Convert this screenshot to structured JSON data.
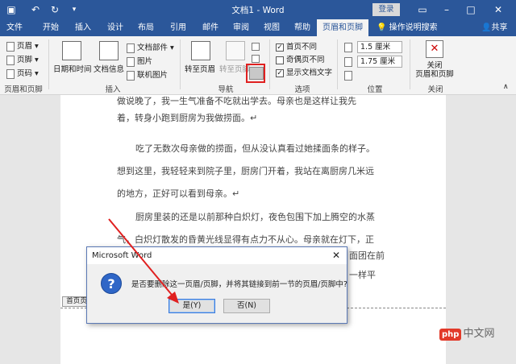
{
  "titlebar": {
    "title": "文档1 - Word",
    "signin": "登录",
    "save_icon": "save-icon",
    "undo_icon": "undo-icon",
    "redo_icon": "redo-icon"
  },
  "tabs": [
    "文件",
    "开始",
    "插入",
    "设计",
    "布局",
    "引用",
    "邮件",
    "审阅",
    "视图",
    "帮助",
    "页眉和页脚"
  ],
  "tell_me": "操作说明搜索",
  "share": "共享",
  "ribbon": {
    "group1": {
      "items": [
        "页眉",
        "页脚",
        "页码"
      ],
      "label": "页眉和页脚"
    },
    "group2": {
      "items": [
        "日期和时间",
        "文档信息",
        "文档部件",
        "图片",
        "联机图片"
      ],
      "label": "插入"
    },
    "group3": {
      "items": [
        "转至页眉",
        "转至页脚"
      ],
      "label": "导航"
    },
    "group4": {
      "items": [
        "首页不同",
        "奇偶页不同",
        "显示文档文字"
      ],
      "checked": [
        true,
        false,
        true
      ],
      "label": "选项"
    },
    "group5": {
      "values": [
        "1.5 厘米",
        "1.75 厘米"
      ],
      "label": "位置"
    },
    "group6": {
      "button": "关闭\n页眉和页脚",
      "label": "关闭"
    }
  },
  "document": {
    "paragraphs": [
      "做说晚了，我一生气准备不吃就出学去。母亲也是这样让我先",
      "着，转身小跑到厨房为我做捞面。↵",
      "吃了无数次母亲做的捞面，但从没认真看过她揉面条的样子。",
      "想到这里，我轻轻来到院子里，厨房门开着，我站在离厨房几米远",
      "的地方，正好可以看到母亲。↵",
      "厨房里装的还是以前那种白炽灯，夜色包围下加上腾空的水蒸",
      "气，白炽灯散发的昏黄光线显得有点力不从心。母亲就在灯下，正",
      "面团在前",
      "一样平"
    ],
    "hf_tag": "首页页"
  },
  "dialog": {
    "title": "Microsoft Word",
    "message": "是否要删除这一页眉/页脚，并将其链接到前一节的页眉/页脚中?",
    "yes": "是(Y)",
    "no": "否(N)"
  },
  "watermark": {
    "badge": "php",
    "text": "中文网"
  }
}
